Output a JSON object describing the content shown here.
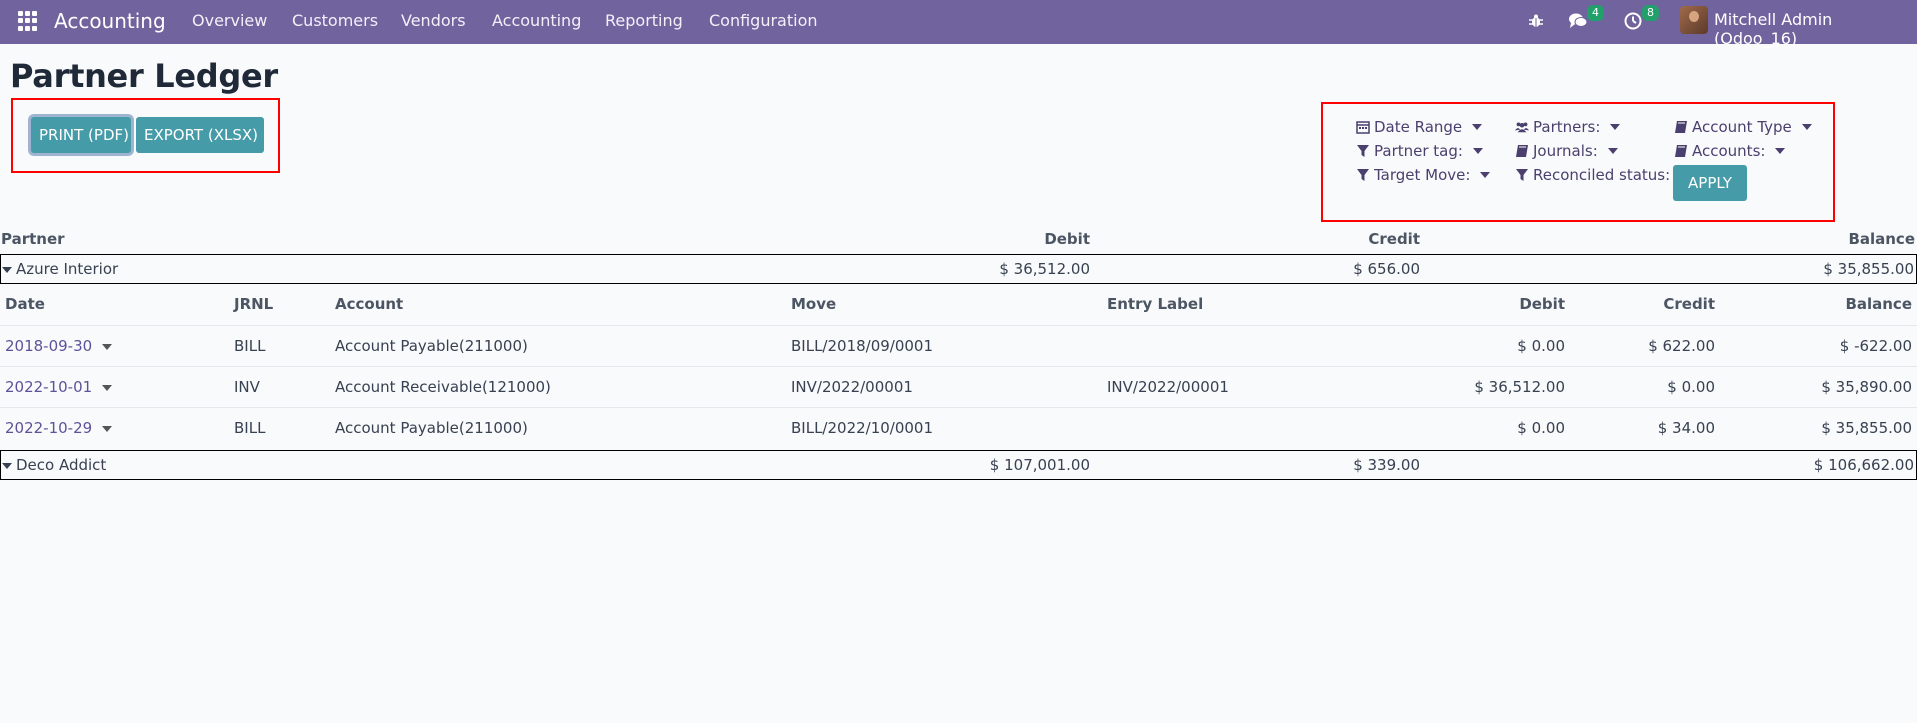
{
  "navbar": {
    "brand": "Accounting",
    "menu": [
      "Overview",
      "Customers",
      "Vendors",
      "Accounting",
      "Reporting",
      "Configuration"
    ],
    "messages_count": "4",
    "activities_count": "8",
    "user": "Mitchell Admin (Odoo_16)"
  },
  "page": {
    "title": "Partner Ledger",
    "print_label": "PRINT (PDF)",
    "export_label": "EXPORT (XLSX)"
  },
  "filters": {
    "date_range": "Date Range",
    "partners": "Partners:",
    "account_type": "Account Type",
    "partner_tag": "Partner tag:",
    "journals": "Journals:",
    "accounts": "Accounts:",
    "target_move": "Target Move:",
    "reconciled_status": "Reconciled status:",
    "apply": "APPLY"
  },
  "summary_headers": {
    "partner": "Partner",
    "debit": "Debit",
    "credit": "Credit",
    "balance": "Balance"
  },
  "partners": [
    {
      "name": "Azure Interior",
      "debit": "$ 36,512.00",
      "credit": "$ 656.00",
      "balance": "$ 35,855.00"
    },
    {
      "name": "Deco Addict",
      "debit": "$ 107,001.00",
      "credit": "$ 339.00",
      "balance": "$ 106,662.00"
    }
  ],
  "detail_headers": {
    "date": "Date",
    "jrnl": "JRNL",
    "account": "Account",
    "move": "Move",
    "entry_label": "Entry Label",
    "debit": "Debit",
    "credit": "Credit",
    "balance": "Balance"
  },
  "lines": [
    {
      "date": "2018-09-30",
      "jrnl": "BILL",
      "account": "Account Payable(211000)",
      "move": "BILL/2018/09/0001",
      "entry_label": "",
      "debit": "$ 0.00",
      "credit": "$ 622.00",
      "balance": "$ -622.00"
    },
    {
      "date": "2022-10-01",
      "jrnl": "INV",
      "account": "Account Receivable(121000)",
      "move": "INV/2022/00001",
      "entry_label": "INV/2022/00001",
      "debit": "$ 36,512.00",
      "credit": "$ 0.00",
      "balance": "$ 35,890.00"
    },
    {
      "date": "2022-10-29",
      "jrnl": "BILL",
      "account": "Account Payable(211000)",
      "move": "BILL/2022/10/0001",
      "entry_label": "",
      "debit": "$ 0.00",
      "credit": "$ 34.00",
      "balance": "$ 35,855.00"
    }
  ],
  "colors": {
    "navbar": "#71639e",
    "button": "#459ba7",
    "highlight_box": "#ff0000",
    "badge": "#22a06b"
  }
}
